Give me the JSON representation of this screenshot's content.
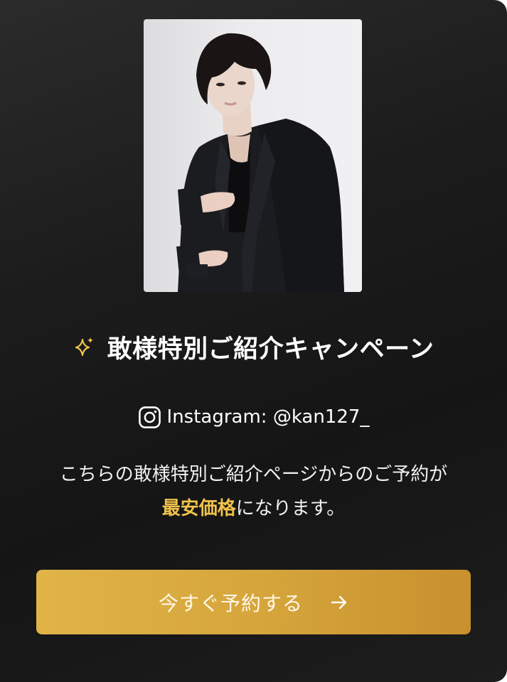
{
  "campaign": {
    "title": "敢様特別ご紹介キャンペーン",
    "instagram": "Instagram: @kan127_",
    "description_line1": "こちらの敢様特別ご紹介ページからのご予約が",
    "description_highlight": "最安価格",
    "description_line2_rest": "になります。",
    "cta_label": "今すぐ予約する"
  },
  "icons": {
    "title": "sparkle-icon",
    "instagram": "instagram-icon",
    "cta": "arrow-right-icon"
  },
  "colors": {
    "accent": "#f0c24b",
    "button_start": "#e1b447",
    "button_end": "#c9902e",
    "card_bg": "#1c1c1c"
  }
}
